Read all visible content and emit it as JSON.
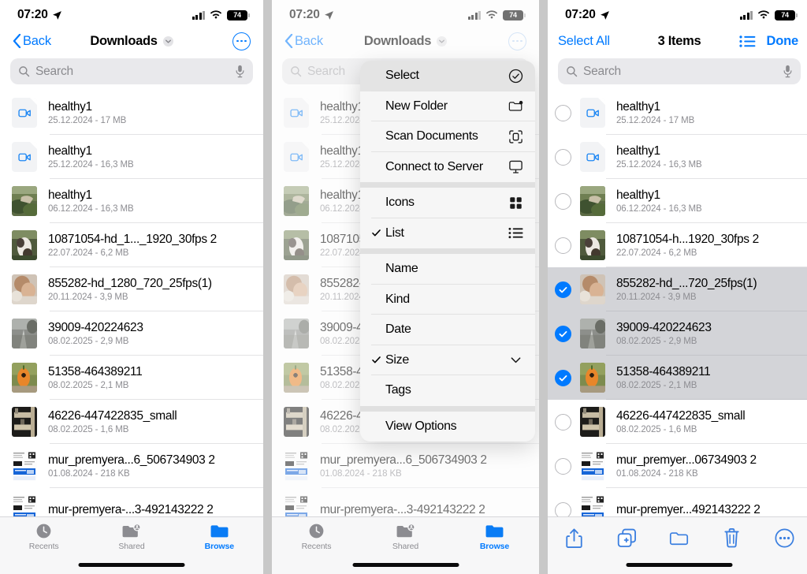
{
  "app": {
    "name": "Files",
    "platform": "iOS"
  },
  "status_bar": {
    "time": "07:20",
    "location_arrow": "location-arrow-icon",
    "cellular": "cellular-bars-icon",
    "wifi": "wifi-icon",
    "battery_percent": "74"
  },
  "colors": {
    "accent": "#007aff",
    "selected_row_bg": "#d3d4d8",
    "search_bg": "#e9e9ec",
    "menu_bg": "#f6f6f6",
    "menu_highlight": "#e4e4e4",
    "subtitle": "#8d8d92"
  },
  "panel1": {
    "nav": {
      "back_label": "Back",
      "title": "Downloads",
      "title_chevron": "chevron-down-icon",
      "more_button": "more-options-icon"
    },
    "search": {
      "placeholder": "Search",
      "search_icon": "search-icon",
      "mic_icon": "microphone-icon"
    },
    "tabbar": {
      "items": [
        {
          "label": "Recents",
          "icon": "clock-icon",
          "active": false
        },
        {
          "label": "Shared",
          "icon": "shared-folder-icon",
          "active": false
        },
        {
          "label": "Browse",
          "icon": "folder-icon",
          "active": true
        }
      ]
    }
  },
  "panel2": {
    "nav": {
      "back_label": "Back",
      "title": "Downloads",
      "more_button": "more-options-icon"
    },
    "search": {
      "placeholder": "Search"
    },
    "menu": {
      "groups": [
        {
          "items": [
            {
              "label": "Select",
              "icon": "check-circle-icon",
              "checked": false,
              "highlighted": true
            },
            {
              "label": "New Folder",
              "icon": "new-folder-icon",
              "checked": false,
              "highlighted": false
            },
            {
              "label": "Scan Documents",
              "icon": "scan-documents-icon",
              "checked": false,
              "highlighted": false
            },
            {
              "label": "Connect to Server",
              "icon": "server-display-icon",
              "checked": false,
              "highlighted": false
            }
          ]
        },
        {
          "items": [
            {
              "label": "Icons",
              "icon": "grid-icon",
              "checked": false,
              "highlighted": false
            },
            {
              "label": "List",
              "icon": "list-icon",
              "checked": true,
              "highlighted": false
            }
          ]
        },
        {
          "items": [
            {
              "label": "Name",
              "icon": "",
              "checked": false,
              "highlighted": false
            },
            {
              "label": "Kind",
              "icon": "",
              "checked": false,
              "highlighted": false
            },
            {
              "label": "Date",
              "icon": "",
              "checked": false,
              "highlighted": false
            },
            {
              "label": "Size",
              "icon": "chevron-down-icon",
              "checked": true,
              "highlighted": false
            },
            {
              "label": "Tags",
              "icon": "",
              "checked": false,
              "highlighted": false
            }
          ]
        },
        {
          "items": [
            {
              "label": "View Options",
              "icon": "",
              "checked": false,
              "highlighted": false
            }
          ]
        }
      ]
    },
    "tabbar": {
      "items": [
        {
          "label": "Recents",
          "icon": "clock-icon",
          "active": false
        },
        {
          "label": "Shared",
          "icon": "shared-folder-icon",
          "active": false
        },
        {
          "label": "Browse",
          "icon": "folder-icon",
          "active": true
        }
      ]
    }
  },
  "panel3": {
    "nav": {
      "select_all_label": "Select All",
      "title": "3 Items",
      "list_view_button": "list-icon",
      "done_label": "Done"
    },
    "search": {
      "placeholder": "Search"
    },
    "toolbar": {
      "items": [
        {
          "name": "share-icon"
        },
        {
          "name": "duplicate-icon"
        },
        {
          "name": "move-to-folder-icon"
        },
        {
          "name": "trash-icon"
        },
        {
          "name": "more-options-icon"
        }
      ]
    }
  },
  "files_full": [
    {
      "name": "healthy1",
      "subtitle": "25.12.2024 - 17 MB",
      "thumb": "video-doc"
    },
    {
      "name": "healthy1",
      "subtitle": "25.12.2024 - 16,3 MB",
      "thumb": "video-doc"
    },
    {
      "name": "healthy1",
      "subtitle": "06.12.2024 - 16,3 MB",
      "thumb": "photo-forest"
    },
    {
      "name": "10871054-hd_1..._1920_30fps 2",
      "subtitle": "22.07.2024 - 6,2 MB",
      "thumb": "photo-dog"
    },
    {
      "name": "855282-hd_1280_720_25fps(1)",
      "subtitle": "20.11.2024 - 3,9 MB",
      "thumb": "photo-hands"
    },
    {
      "name": "39009-420224623",
      "subtitle": "08.02.2025 - 2,9 MB",
      "thumb": "photo-road"
    },
    {
      "name": "51358-464389211",
      "subtitle": "08.02.2025 - 2,1 MB",
      "thumb": "photo-pumpkin"
    },
    {
      "name": "46226-447422835_small",
      "subtitle": "08.02.2025 - 1,6 MB",
      "thumb": "photo-shelf"
    },
    {
      "name": "mur_premyera...6_506734903 2",
      "subtitle": "01.08.2024 - 218 KB",
      "thumb": "photo-doc"
    },
    {
      "name": "mur-premyera-...3-492143222 2",
      "subtitle": "",
      "thumb": "photo-doc"
    }
  ],
  "files_selectmode": [
    {
      "name": "healthy1",
      "subtitle": "25.12.2024 - 17 MB",
      "thumb": "video-doc",
      "selected": false
    },
    {
      "name": "healthy1",
      "subtitle": "25.12.2024 - 16,3 MB",
      "thumb": "video-doc",
      "selected": false
    },
    {
      "name": "healthy1",
      "subtitle": "06.12.2024 - 16,3 MB",
      "thumb": "photo-forest",
      "selected": false
    },
    {
      "name": "10871054-h...1920_30fps 2",
      "subtitle": "22.07.2024 - 6,2 MB",
      "thumb": "photo-dog",
      "selected": false
    },
    {
      "name": "855282-hd_...720_25fps(1)",
      "subtitle": "20.11.2024 - 3,9 MB",
      "thumb": "photo-hands",
      "selected": true
    },
    {
      "name": "39009-420224623",
      "subtitle": "08.02.2025 - 2,9 MB",
      "thumb": "photo-road",
      "selected": true
    },
    {
      "name": "51358-464389211",
      "subtitle": "08.02.2025 - 2,1 MB",
      "thumb": "photo-pumpkin",
      "selected": true
    },
    {
      "name": "46226-447422835_small",
      "subtitle": "08.02.2025 - 1,6 MB",
      "thumb": "photo-shelf",
      "selected": false
    },
    {
      "name": "mur_premyer...06734903 2",
      "subtitle": "01.08.2024 - 218 KB",
      "thumb": "photo-doc",
      "selected": false
    },
    {
      "name": "mur-premyer...492143222 2",
      "subtitle": "",
      "thumb": "photo-doc",
      "selected": false
    }
  ]
}
